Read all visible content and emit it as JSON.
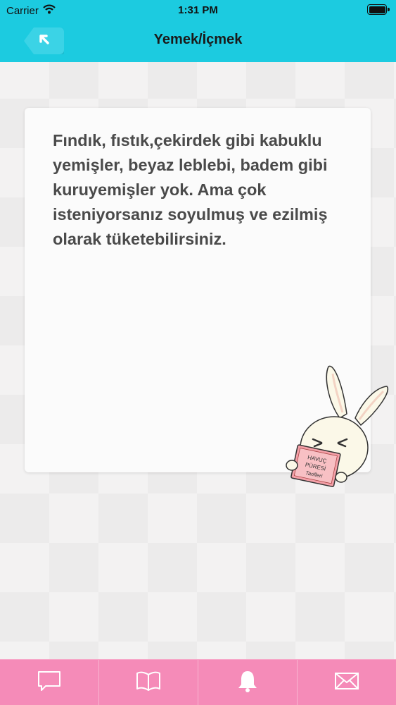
{
  "status_bar": {
    "carrier": "Carrier",
    "time": "1:31 PM",
    "icons": [
      "wifi-icon",
      "battery-icon"
    ]
  },
  "nav": {
    "title": "Yemek/İçmek",
    "back_icon": "back-arrow-icon"
  },
  "card": {
    "text": "Fındık, fıstık,çekirdek gibi kabuklu yemişler, beyaz leblebi, badem gibi kuruyemişler yok. Ama çok isteniyorsanız soyulmuş ve ezilmiş olarak tüketebilirsiniz."
  },
  "mascot": {
    "book_text": "HAVUÇ PÜRESİ Tarifleri"
  },
  "tab_bar": {
    "tabs": [
      {
        "icon": "chat-icon"
      },
      {
        "icon": "book-icon"
      },
      {
        "icon": "bell-icon"
      },
      {
        "icon": "mail-icon"
      }
    ]
  },
  "colors": {
    "header": "#1ccbe0",
    "tab_bar": "#f58bb8",
    "text": "#4a4a4a"
  }
}
